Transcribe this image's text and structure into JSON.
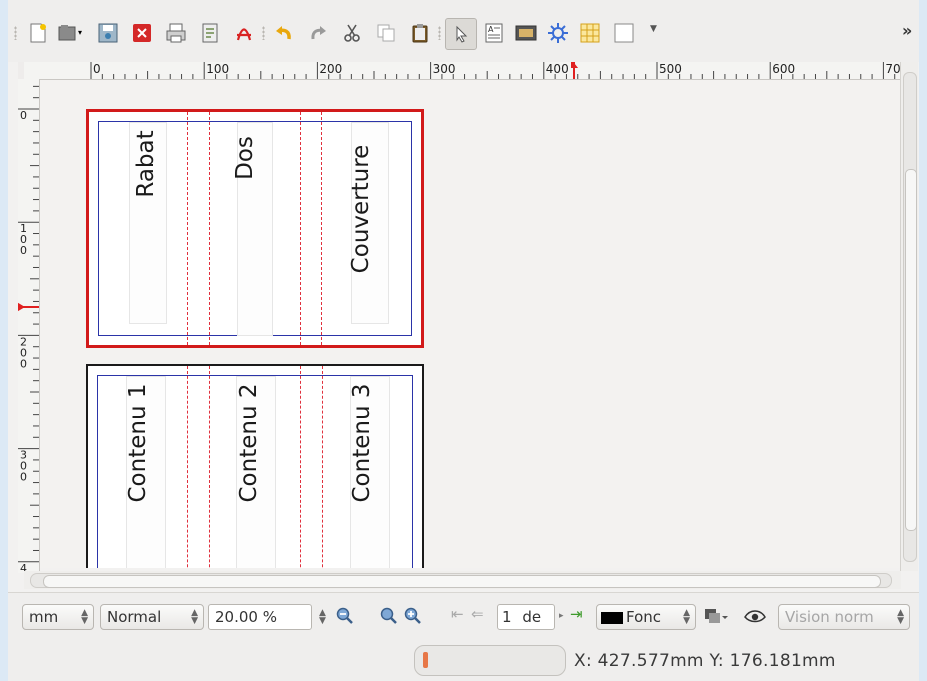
{
  "toolbar": {
    "icons": [
      "new-document",
      "open",
      "save",
      "close",
      "print",
      "preflight",
      "export-pdf",
      "undo",
      "redo",
      "cut",
      "copy",
      "paste",
      "select",
      "text-frame",
      "image-frame",
      "render-frame",
      "table",
      "shape"
    ],
    "more_symbol": "»"
  },
  "ruler": {
    "h_labels": [
      "0",
      "100",
      "200",
      "300",
      "400",
      "500",
      "600",
      "70"
    ],
    "v_labels": [
      [
        "0"
      ],
      [
        "1",
        "0",
        "0"
      ],
      [
        "2",
        "0",
        "0"
      ],
      [
        "3",
        "0",
        "0"
      ],
      [
        "4"
      ]
    ]
  },
  "pages": {
    "page1_labels": [
      "Rabat",
      "Dos",
      "Couverture"
    ],
    "page2_labels": [
      "Contenu 1",
      "Contenu 2",
      "Contenu 3"
    ]
  },
  "status": {
    "unit": "mm",
    "mode": "Normal",
    "zoom": "20.00 %",
    "page_number": "1",
    "page_of": "de",
    "layer": "Fonc",
    "view_mode": "Vision norm"
  },
  "info": {
    "coordinates": "X: 427.577mm  Y: 176.181mm",
    "progress": 0.0
  },
  "colors": {
    "page_border_active": "#d21a1a",
    "margin": "#2b34a8",
    "guide": "#e0303d",
    "layer_swatch": "#000000"
  }
}
